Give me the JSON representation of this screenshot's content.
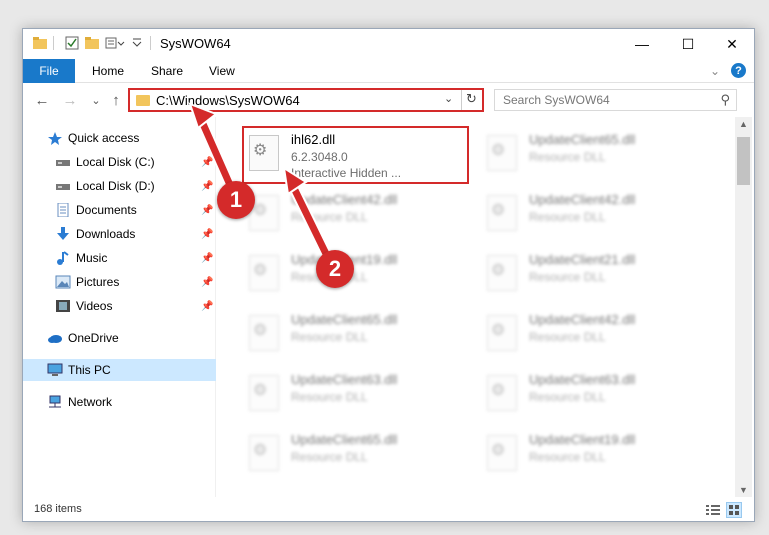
{
  "window": {
    "title": "SysWOW64",
    "minimize": "—",
    "maximize": "☐",
    "close": "✕"
  },
  "ribbon": {
    "tabs": [
      "File",
      "Home",
      "Share",
      "View"
    ],
    "collapse": "⌄",
    "help": "?"
  },
  "navbar": {
    "back": "←",
    "forward": "→",
    "recent": "⌄",
    "up": "↑",
    "address": "C:\\Windows\\SysWOW64",
    "search_placeholder": "Search SysWOW64"
  },
  "sidebar": {
    "items": [
      {
        "label": "Quick access",
        "icon": "star-icon"
      },
      {
        "label": "Local Disk (C:)",
        "icon": "drive-icon",
        "pinned": true
      },
      {
        "label": "Local Disk (D:)",
        "icon": "drive-icon",
        "pinned": true
      },
      {
        "label": "Documents",
        "icon": "documents-icon",
        "pinned": true
      },
      {
        "label": "Downloads",
        "icon": "downloads-icon",
        "pinned": true
      },
      {
        "label": "Music",
        "icon": "music-icon",
        "pinned": true
      },
      {
        "label": "Pictures",
        "icon": "pictures-icon",
        "pinned": true
      },
      {
        "label": "Videos",
        "icon": "videos-icon",
        "pinned": true
      },
      {
        "label": "OneDrive",
        "icon": "onedrive-icon"
      },
      {
        "label": "This PC",
        "icon": "this-pc-icon",
        "selected": true
      },
      {
        "label": "Network",
        "icon": "network-icon"
      }
    ]
  },
  "files": {
    "highlighted": {
      "name": "ihl62.dll",
      "version": "6.2.3048.0",
      "description": "Interactive Hidden ..."
    },
    "others": [
      {
        "name": "UpdateClient65.dll",
        "type": "Resource DLL"
      },
      {
        "name": "UpdateClient42.dll",
        "type": "Resource DLL"
      },
      {
        "name": "UpdateClient42.dll",
        "type": "Resource DLL"
      },
      {
        "name": "UpdateClient19.dll",
        "type": "Resource DLL"
      },
      {
        "name": "UpdateClient21.dll",
        "type": "Resource DLL"
      },
      {
        "name": "UpdateClient65.dll",
        "type": "Resource DLL"
      },
      {
        "name": "UpdateClient42.dll",
        "type": "Resource DLL"
      },
      {
        "name": "UpdateClient63.dll",
        "type": "Resource DLL"
      },
      {
        "name": "UpdateClient63.dll",
        "type": "Resource DLL"
      },
      {
        "name": "UpdateClient65.dll",
        "type": "Resource DLL"
      },
      {
        "name": "UpdateClient19.dll",
        "type": "Resource DLL"
      }
    ]
  },
  "status": {
    "item_count": "168 items"
  },
  "annotations": {
    "step1": "1",
    "step2": "2",
    "color": "#d42a2a"
  }
}
